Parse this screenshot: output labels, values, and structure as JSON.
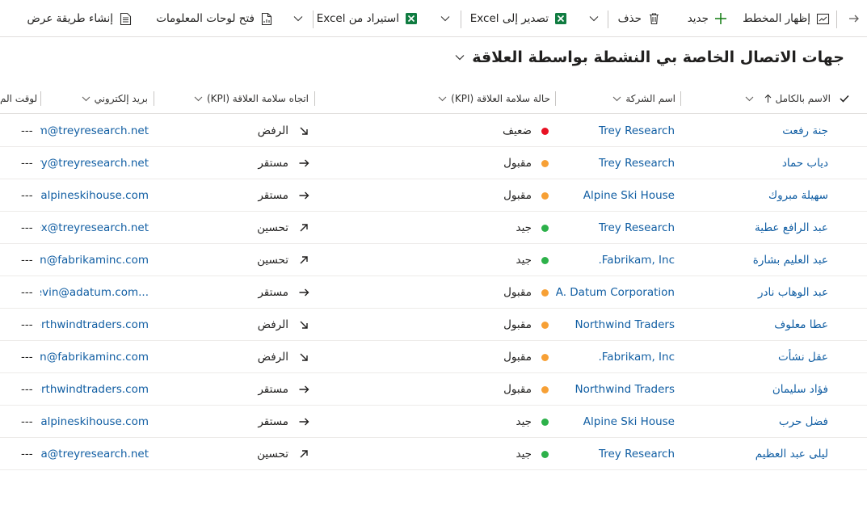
{
  "commandbar": {
    "back_icon": "arrow-right-icon",
    "show_chart": "إظهار المخطط",
    "new": "جديد",
    "delete": "حذف",
    "export_excel": "تصدير إلى Excel",
    "import_excel": "استيراد من Excel",
    "open_dashboards": "فتح لوحات المعلومات",
    "create_view": "إنشاء طريقة عرض"
  },
  "view": {
    "title": "جهات الاتصال الخاصة بي النشطة بواسطة العلاقة"
  },
  "columns": {
    "full_name": "الاسم بالكامل",
    "company": "اسم الشركة",
    "health_state": "حالة سلامة العلاقة (KPI)",
    "health_trend": "اتجاه سلامة العلاقة (KPI)",
    "email": "بريد إلكتروني",
    "time": "الوقت الم"
  },
  "rows": [
    {
      "name": "جنة رفعت",
      "company": "Trey Research",
      "state": "ضعيف",
      "state_color": "#e81123",
      "trend": "الرفض",
      "trend_icon": "arrow-down-right-icon",
      "email": "kim@treyresearch.net",
      "time": "---"
    },
    {
      "name": "دياب حماد",
      "company": "Trey Research",
      "state": "مقبول",
      "state_color": "#f7a035",
      "trend": "مستقر",
      "trend_icon": "arrow-right-icon",
      "email": "ery@treyresearch.net",
      "time": "---"
    },
    {
      "name": "سهيلة مبروك",
      "company": "Alpine Ski House",
      "state": "مقبول",
      "state_color": "#f7a035",
      "trend": "مستقر",
      "trend_icon": "arrow-right-icon",
      "email": "@alpineskihouse.com",
      "time": "---"
    },
    {
      "name": "عبد الرافع عطية",
      "company": "Trey Research",
      "state": "جيد",
      "state_color": "#2db14a",
      "trend": "تحسين",
      "trend_icon": "arrow-up-right-icon",
      "email": "alex@treyresearch.net",
      "time": "---"
    },
    {
      "name": "عبد العليم بشارة",
      "company": "Fabrikam, Inc.",
      "state": "جيد",
      "state_color": "#2db14a",
      "trend": "تحسين",
      "trend_icon": "arrow-up-right-icon",
      "email": "un@fabrikaminc.com",
      "time": "---"
    },
    {
      "name": "عبد الوهاب نادر",
      "company": "A. Datum Corporation",
      "state": "مقبول",
      "state_color": "#f7a035",
      "trend": "مستقر",
      "trend_icon": "arrow-right-icon",
      "email": "kevin@adatum.com...",
      "time": "---"
    },
    {
      "name": "عطا معلوف",
      "company": "Northwind Traders",
      "state": "مقبول",
      "state_color": "#f7a035",
      "trend": "الرفض",
      "trend_icon": "arrow-down-right-icon",
      "email": "northwindtraders.com",
      "time": "---"
    },
    {
      "name": "عقل نشأت",
      "company": "Fabrikam, Inc.",
      "state": "مقبول",
      "state_color": "#f7a035",
      "trend": "الرفض",
      "trend_icon": "arrow-down-right-icon",
      "email": "can@fabrikaminc.com",
      "time": "---"
    },
    {
      "name": "فؤاد سليمان",
      "company": "Northwind Traders",
      "state": "مقبول",
      "state_color": "#f7a035",
      "trend": "مستقر",
      "trend_icon": "arrow-right-icon",
      "email": "northwindtraders.com",
      "time": "---"
    },
    {
      "name": "فضل حرب",
      "company": "Alpine Ski House",
      "state": "جيد",
      "state_color": "#2db14a",
      "trend": "مستقر",
      "trend_icon": "arrow-right-icon",
      "email": "@alpineskihouse.com",
      "time": "---"
    },
    {
      "name": "ليلى عبد العظيم",
      "company": "Trey Research",
      "state": "جيد",
      "state_color": "#2db14a",
      "trend": "تحسين",
      "trend_icon": "arrow-up-right-icon",
      "email": "arla@treyresearch.net",
      "time": "---"
    }
  ]
}
